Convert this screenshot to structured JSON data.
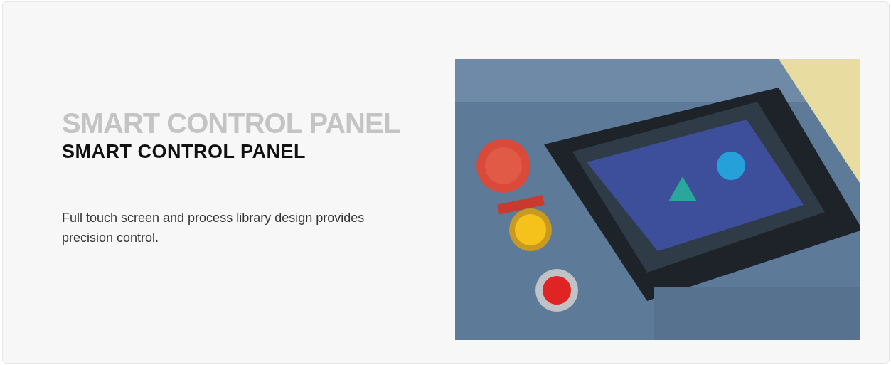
{
  "section": {
    "ghost_title": "SMART CONTROL PANEL",
    "title": "SMART CONTROL PANEL",
    "description": "Full touch screen and process library design provides precision control."
  }
}
